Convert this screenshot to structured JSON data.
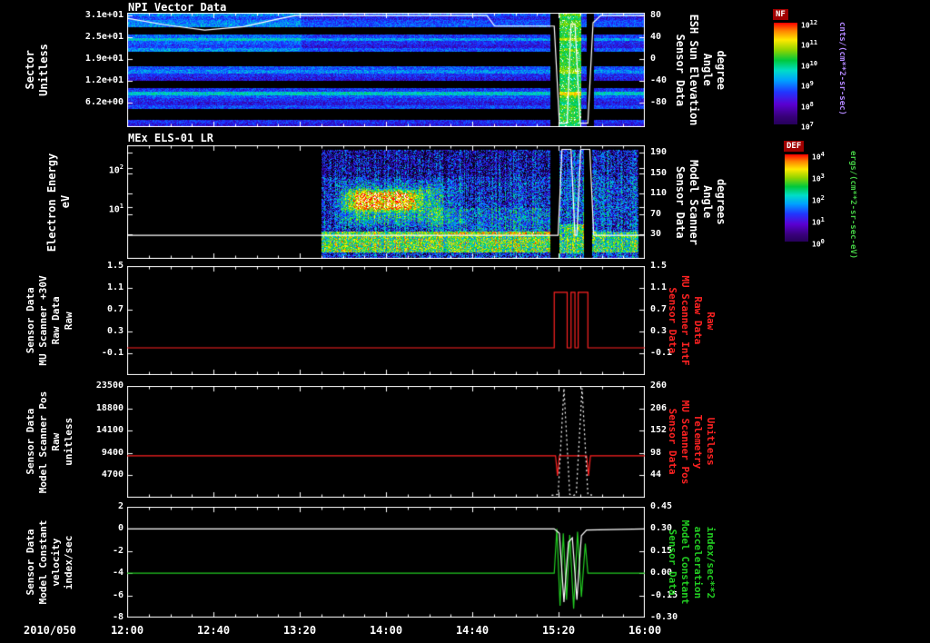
{
  "figure": {
    "date_label": "2010/050",
    "xticks": [
      "12:00",
      "12:40",
      "13:20",
      "14:00",
      "14:40",
      "15:20",
      "16:00"
    ],
    "background": "#000000",
    "axis_color": "#ffffff"
  },
  "chart_data": [
    {
      "id": "npi",
      "type": "spectrogram",
      "title": "NPI Vector Data",
      "left_title": [
        "Sector",
        "Unitless"
      ],
      "left_ticks": {
        "labels": [
          "3.1e+01",
          "2.5e+01",
          "1.9e+01",
          "1.2e+01",
          "6.2e+00"
        ],
        "fracs": [
          0.024,
          0.214,
          0.405,
          0.595,
          0.786
        ]
      },
      "right_ticks": {
        "labels": [
          "80",
          "40",
          "0",
          "-40",
          "-80"
        ],
        "fracs": [
          0.024,
          0.214,
          0.405,
          0.595,
          0.786
        ]
      },
      "right_title": [
        "Sensor Data",
        "ESH Sun Elevation",
        "Angle",
        "degree"
      ],
      "right_title_color": "#ffffff",
      "xrange": [
        12,
        16
      ],
      "right_range": [
        80,
        -125
      ],
      "rows": [
        0.3,
        0.22,
        0.28,
        0.3,
        -1,
        -1,
        0.26,
        0.38,
        0.24,
        0.2,
        0.3,
        -1,
        -1,
        -1,
        -1,
        0.3,
        0.36,
        0.24,
        0.2,
        -1,
        -1,
        0.26,
        0.46,
        0.3,
        0.24,
        0.2,
        0.28,
        -1,
        -1,
        -1,
        0.24,
        0.2
      ],
      "features": [
        {
          "t0": 12.0,
          "t1": 13.35,
          "f0": 0.0,
          "f1": 0.4,
          "amp": 0.07
        },
        {
          "t0": 15.34,
          "t1": 15.51,
          "f0": 0.0,
          "f1": 1.0,
          "amp": 0.35,
          "sparkle": 0.07,
          "override": 1
        },
        {
          "t0": 15.27,
          "t1": 15.34,
          "f0": 0.0,
          "f1": 1.0,
          "amp": -9
        },
        {
          "t0": 15.55,
          "t1": 15.61,
          "f0": 0.0,
          "f1": 1.0,
          "amp": -9
        }
      ],
      "noise": 0.1,
      "overlays": [
        {
          "color": "#ffffff",
          "axis": "right",
          "width": 1.2,
          "points": [
            [
              12,
              70
            ],
            [
              12.3,
              58
            ],
            [
              12.6,
              49
            ],
            [
              12.9,
              55
            ],
            [
              13.15,
              68
            ],
            [
              13.3,
              75
            ],
            [
              14.78,
              75
            ],
            [
              14.84,
              56
            ],
            [
              15.27,
              56
            ],
            [
              15.3,
              56
            ],
            [
              15.34,
              -118
            ],
            [
              15.4,
              -118
            ],
            [
              15.43,
              60
            ],
            [
              15.46,
              60
            ],
            [
              15.5,
              -118
            ],
            [
              15.56,
              -118
            ],
            [
              15.6,
              62
            ],
            [
              15.66,
              75
            ],
            [
              16,
              75
            ]
          ]
        }
      ],
      "colorbar": {
        "label": "NF",
        "ticks": [
          "10^12",
          "10^11",
          "10^10",
          "10^9",
          "10^8",
          "10^7"
        ],
        "unit": "cnts/(cm**2-sr-sec)",
        "unit_color": "#b388ff"
      }
    },
    {
      "id": "els",
      "type": "spectrogram",
      "title": "MEx ELS-01 LR",
      "left_title": [
        "Electron Energy",
        "eV"
      ],
      "left_ticks": {
        "labels": [
          "10^2",
          "10^1"
        ],
        "fracs": [
          0.2,
          0.544
        ]
      },
      "right_ticks": {
        "labels": [
          "190",
          "150",
          "110",
          "70",
          "30"
        ],
        "fracs": [
          0.064,
          0.244,
          0.424,
          0.604,
          0.784
        ]
      },
      "right_title": [
        "Sensor Data",
        "Model Scanner",
        "Angle",
        "degrees"
      ],
      "right_title_color": "#ffffff",
      "xrange": [
        12,
        16
      ],
      "right_range": [
        204,
        -18
      ],
      "base_regions": [
        {
          "t0": 13.5,
          "t1": 15.27,
          "f0": 0.04,
          "f1": 1.0,
          "amp": 0.22
        },
        {
          "t0": 15.34,
          "t1": 15.53,
          "f0": 0.04,
          "f1": 1.0,
          "amp": 0.3
        },
        {
          "t0": 15.59,
          "t1": 15.95,
          "f0": 0.04,
          "f1": 1.0,
          "amp": 0.26
        }
      ],
      "features": [
        {
          "t0": 13.5,
          "t1": 15.27,
          "f0": 0.76,
          "f1": 0.94,
          "amp": 0.42
        },
        {
          "t0": 13.55,
          "t1": 14.6,
          "f0": 0.3,
          "f1": 0.75,
          "amp": 0.26,
          "soft": 1
        },
        {
          "t0": 13.63,
          "t1": 14.32,
          "f0": 0.38,
          "f1": 0.6,
          "amp": 0.42,
          "soft": 1
        },
        {
          "t0": 14.35,
          "t1": 15.27,
          "f0": 0.55,
          "f1": 0.8,
          "amp": 0.12
        },
        {
          "t0": 15.34,
          "t1": 15.53,
          "f0": 0.7,
          "f1": 0.95,
          "amp": 0.3
        },
        {
          "t0": 15.59,
          "t1": 15.95,
          "f0": 0.76,
          "f1": 0.94,
          "amp": 0.3
        },
        {
          "t0": 13.5,
          "t1": 15.95,
          "f0": 0.04,
          "f1": 0.28,
          "amp": -0.08
        }
      ],
      "noise": 0.26,
      "col_noise": 0.12,
      "overlays": [
        {
          "color": "#ffffff",
          "axis": "right",
          "width": 1.2,
          "points": [
            [
              12,
              28
            ],
            [
              15.3,
              28
            ],
            [
              15.33,
              28
            ],
            [
              15.36,
              196
            ],
            [
              15.43,
              196
            ],
            [
              15.46,
              28
            ],
            [
              15.475,
              28
            ],
            [
              15.505,
              196
            ],
            [
              15.575,
              196
            ],
            [
              15.605,
              28
            ],
            [
              16,
              28
            ]
          ]
        }
      ],
      "colorbar": {
        "label": "DEF",
        "ticks": [
          "10^4",
          "10^3",
          "10^2",
          "10^1",
          "10^0"
        ],
        "unit": "ergs/(cm**2-sr-sec-eV)",
        "unit_color": "#44cc44"
      }
    },
    {
      "id": "mu-scanner-30v",
      "type": "line",
      "left_title": [
        "Sensor Data",
        "MU Scanner +30V",
        "Raw Data",
        "Raw"
      ],
      "left_ticks": {
        "labels": [
          "1.5",
          "1.1",
          "0.7",
          "0.3",
          "-0.1"
        ],
        "fracs": [
          0,
          0.2,
          0.4,
          0.6,
          0.8
        ]
      },
      "right_ticks": {
        "labels": [
          "1.5",
          "1.1",
          "0.7",
          "0.3",
          "-0.1"
        ],
        "fracs": [
          0,
          0.2,
          0.4,
          0.6,
          0.8
        ]
      },
      "right_title": [
        "Sensor Data",
        "MU Scanner IntF",
        "Raw Data",
        "Raw"
      ],
      "right_title_color": "#ff2222",
      "xrange": [
        12,
        16
      ],
      "left_range": [
        1.5,
        -0.5
      ],
      "right_range": [
        1.5,
        -0.5
      ],
      "series": [
        {
          "color": "#ff2222",
          "axis": "left",
          "width": 1.2,
          "points": [
            [
              12,
              0
            ],
            [
              15.3,
              0
            ],
            [
              15.3,
              1.02
            ],
            [
              15.4,
              1.02
            ],
            [
              15.4,
              0
            ],
            [
              15.43,
              0
            ],
            [
              15.43,
              1.02
            ],
            [
              15.46,
              1.02
            ],
            [
              15.46,
              0
            ],
            [
              15.485,
              0
            ],
            [
              15.485,
              1.02
            ],
            [
              15.56,
              1.02
            ],
            [
              15.56,
              0
            ],
            [
              16,
              0
            ]
          ]
        }
      ]
    },
    {
      "id": "model-scanner-pos",
      "type": "line",
      "left_title": [
        "Sensor Data",
        "Model Scanner Pos",
        "Raw",
        "unitless"
      ],
      "left_ticks": {
        "labels": [
          "23500",
          "18800",
          "14100",
          "9400",
          "4700"
        ],
        "fracs": [
          0,
          0.2,
          0.4,
          0.6,
          0.8
        ]
      },
      "right_ticks": {
        "labels": [
          "260",
          "206",
          "152",
          "98",
          "44"
        ],
        "fracs": [
          0,
          0.2,
          0.4,
          0.6,
          0.8
        ]
      },
      "right_title": [
        "Sensor Data",
        "MU Scanner Pos",
        "Telemetry",
        "Unitless"
      ],
      "right_title_color": "#ff2222",
      "xrange": [
        12,
        16
      ],
      "left_range": [
        23500,
        0
      ],
      "right_range": [
        260,
        -10
      ],
      "series": [
        {
          "color": "#ff2222",
          "axis": "left",
          "width": 1.2,
          "points": [
            [
              12,
              8800
            ],
            [
              15.31,
              8800
            ],
            [
              15.325,
              4600
            ],
            [
              15.34,
              8800
            ],
            [
              15.55,
              8800
            ],
            [
              15.565,
              4600
            ],
            [
              15.58,
              8800
            ],
            [
              16,
              8800
            ]
          ]
        },
        {
          "color": "#ffffff",
          "axis": "left",
          "width": 1.2,
          "dash": [
            2,
            3
          ],
          "points": [
            [
              15.28,
              500
            ],
            [
              15.33,
              700
            ],
            [
              15.375,
              23000
            ],
            [
              15.42,
              700
            ],
            [
              15.45,
              500
            ],
            [
              15.47,
              700
            ],
            [
              15.515,
              23000
            ],
            [
              15.56,
              700
            ],
            [
              15.6,
              500
            ]
          ]
        }
      ]
    },
    {
      "id": "model-constant",
      "type": "line",
      "left_title": [
        "Sensor Data",
        "Model Constant",
        "velocity",
        "index/sec"
      ],
      "left_ticks": {
        "labels": [
          "2",
          "0",
          "-2",
          "-4",
          "-6",
          "-8"
        ],
        "fracs": [
          0,
          0.2,
          0.4,
          0.6,
          0.8,
          1.0
        ]
      },
      "right_ticks": {
        "labels": [
          "0.45",
          "0.30",
          "0.15",
          "0.00",
          "-0.15",
          "-0.30"
        ],
        "fracs": [
          0,
          0.2,
          0.4,
          0.6,
          0.8,
          1.0
        ]
      },
      "right_title": [
        "Sensor Data",
        "Model Constant",
        "acceleration",
        "index/sec**2"
      ],
      "right_title_color": "#22cc22",
      "xrange": [
        12,
        16
      ],
      "left_range": [
        2,
        -8
      ],
      "right_range": [
        0.45,
        -0.3
      ],
      "series": [
        {
          "color": "#22cc22",
          "axis": "right",
          "width": 1.2,
          "points": [
            [
              12,
              0
            ],
            [
              15.3,
              0
            ],
            [
              15.32,
              0.3
            ],
            [
              15.345,
              -0.22
            ],
            [
              15.37,
              0.27
            ],
            [
              15.395,
              -0.18
            ],
            [
              15.42,
              0.26
            ],
            [
              15.45,
              -0.24
            ],
            [
              15.48,
              0.28
            ],
            [
              15.51,
              -0.16
            ],
            [
              15.54,
              0.2
            ],
            [
              15.56,
              0
            ],
            [
              16,
              0
            ]
          ]
        },
        {
          "color": "#ffffff",
          "axis": "left",
          "width": 1.2,
          "points": [
            [
              12,
              0
            ],
            [
              15.3,
              0
            ],
            [
              15.34,
              -0.4
            ],
            [
              15.375,
              -6.6
            ],
            [
              15.41,
              -1.2
            ],
            [
              15.44,
              -0.8
            ],
            [
              15.475,
              -6.4
            ],
            [
              15.51,
              -0.6
            ],
            [
              15.55,
              -0.1
            ],
            [
              16,
              0
            ]
          ]
        }
      ]
    }
  ]
}
